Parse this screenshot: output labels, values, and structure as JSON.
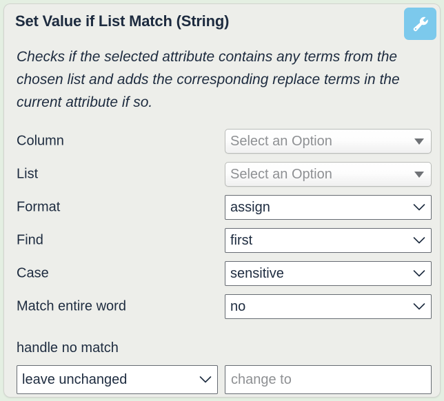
{
  "panel": {
    "title": "Set Value if List Match (String)",
    "description": "Checks if the selected attribute contains any terms from the chosen list and adds the corresponding replace terms in the current attribute if so.",
    "tool_icon": "wrench-icon",
    "accent_color": "#7cc9ec",
    "background_color": "#edeeea",
    "outer_background_color": "#e4efe2",
    "text_color": "#1d2b3f"
  },
  "fields": [
    {
      "label": "Column",
      "name": "column",
      "value": "Select an Option",
      "disabled": true,
      "arrow": "triangle-down-icon"
    },
    {
      "label": "List",
      "name": "list",
      "value": "Select an Option",
      "disabled": true,
      "arrow": "triangle-down-icon"
    },
    {
      "label": "Format",
      "name": "format",
      "value": "assign",
      "disabled": false,
      "arrow": "chevron-down-icon"
    },
    {
      "label": "Find",
      "name": "find",
      "value": "first",
      "disabled": false,
      "arrow": "chevron-down-icon"
    },
    {
      "label": "Case",
      "name": "case",
      "value": "sensitive",
      "disabled": false,
      "arrow": "chevron-down-icon"
    },
    {
      "label": "Match entire word",
      "name": "match-entire-word",
      "value": "no",
      "disabled": false,
      "arrow": "chevron-down-icon"
    }
  ],
  "no_match": {
    "label": "handle no match",
    "select_value": "leave unchanged",
    "select_arrow": "chevron-down-icon",
    "input_value": "",
    "input_placeholder": "change to"
  }
}
